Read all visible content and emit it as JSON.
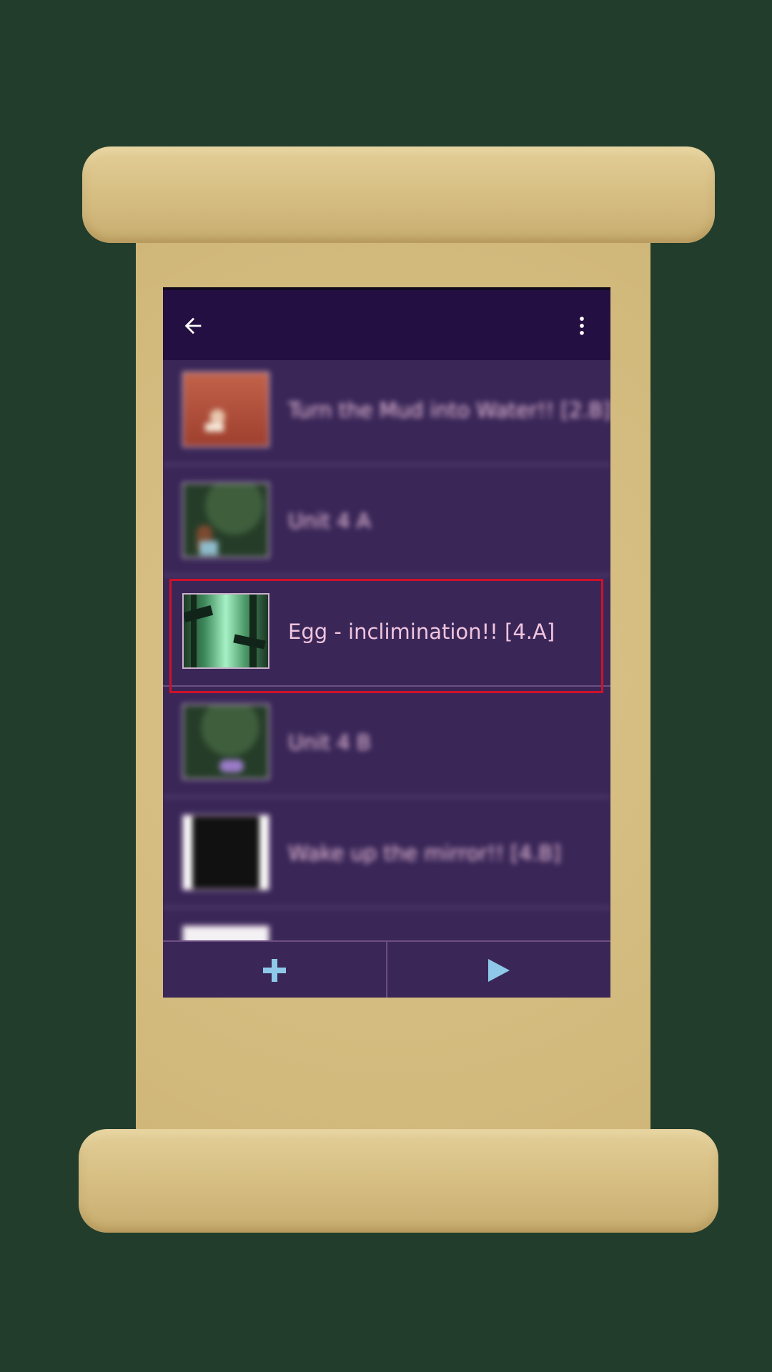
{
  "app_bar": {
    "back_icon": "arrow-left-icon",
    "menu_icon": "more-vert-icon"
  },
  "lessons": [
    {
      "title": "Turn the Mud into Water!! [2.B]",
      "thumb": "red-mud-scene"
    },
    {
      "title": "Unit 4 A",
      "thumb": "forest-girl-scene"
    },
    {
      "title": "Egg - inclimination!! [4.A]",
      "thumb": "green-forest-scene",
      "selected": true
    },
    {
      "title": "Unit 4 B",
      "thumb": "forest-creature-scene"
    },
    {
      "title": "Wake up the mirror!! [4.B]",
      "thumb": "black-mirror-scene"
    },
    {
      "title": "",
      "thumb": "white-card"
    }
  ],
  "bottom_bar": {
    "add_icon": "plus-icon",
    "play_icon": "play-icon"
  },
  "colors": {
    "background": "#223d2b",
    "app_bar": "#240f42",
    "list_bg": "#3a2758",
    "label": "#f0c4de",
    "accent_icon": "#8ec9ea",
    "selection": "#d0102a"
  }
}
